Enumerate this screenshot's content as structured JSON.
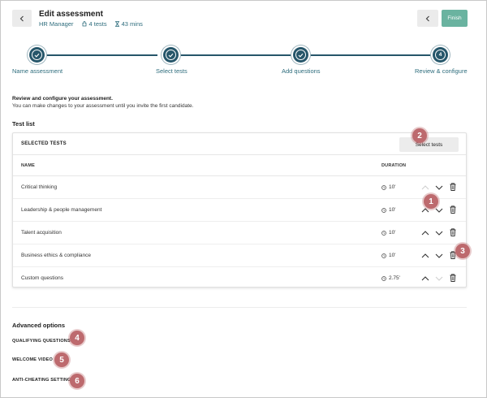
{
  "header": {
    "title": "Edit assessment",
    "role": "HR Manager",
    "tests_count": "4 tests",
    "duration": "43 mins",
    "finish_label": "Finish"
  },
  "steps": [
    {
      "label": "Name assessment",
      "status": "done"
    },
    {
      "label": "Select tests",
      "status": "done"
    },
    {
      "label": "Add questions",
      "status": "done"
    },
    {
      "label": "Review & configure",
      "status": "current",
      "number": "4"
    }
  ],
  "intro": {
    "heading": "Review and configure your assessment.",
    "text": "You can make changes to your assessment until you invite the first candidate."
  },
  "test_list": {
    "heading": "Test list",
    "card_title": "SELECTED TESTS",
    "select_button": "Select tests",
    "col_name": "NAME",
    "col_duration": "DURATION",
    "rows": [
      {
        "name": "Critical thinking",
        "duration": "10'"
      },
      {
        "name": "Leadership & people management",
        "duration": "10'"
      },
      {
        "name": "Talent acquisition",
        "duration": "10'"
      },
      {
        "name": "Business ethics & compliance",
        "duration": "10'"
      },
      {
        "name": "Custom questions",
        "duration": "2.75'"
      }
    ]
  },
  "advanced": {
    "heading": "Advanced options",
    "options": [
      "QUALIFYING QUESTIONS",
      "WELCOME VIDEO",
      "ANTI-CHEATING SETTINGS"
    ]
  },
  "callouts": [
    "1",
    "2",
    "3",
    "4",
    "5",
    "6"
  ],
  "colors": {
    "accent": "#26566a",
    "finish": "#6ab3a0",
    "callout": "#bd6a6e",
    "link": "#2d6c7c"
  }
}
